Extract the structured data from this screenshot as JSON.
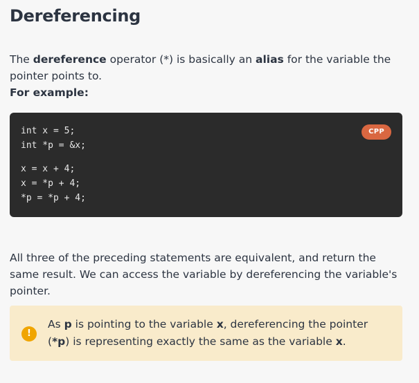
{
  "title": "Dereferencing",
  "intro": {
    "p1": "The ",
    "term_dereference": "dereference",
    "p2": " operator (*) is basically an ",
    "term_alias": "alias",
    "p3": " for the variable the pointer points to."
  },
  "example_label": "For example:",
  "code": {
    "language_badge": "CPP",
    "group1": [
      "int x = 5;",
      "int *p = &x;"
    ],
    "group2": [
      "x = x + 4;",
      "x = *p + 4;",
      "*p = *p + 4;"
    ]
  },
  "summary": "All three of the preceding statements are equivalent, and return the same result. We can access the variable by dereferencing the variable's pointer.",
  "callout": {
    "icon": "warning-icon",
    "icon_glyph": "!",
    "s1": "As ",
    "b1": "p",
    "s2": " is pointing to the variable ",
    "b2": "x",
    "s3": ", dereferencing the pointer (",
    "b3": "*p",
    "s4": ") is representing exactly the same as the variable ",
    "b4": "x",
    "s5": "."
  },
  "colors": {
    "background": "#f7f7f7",
    "code_background": "#2b2b2b",
    "badge": "#d96741",
    "callout_background": "#f9ebcb",
    "callout_icon": "#f0a500",
    "text": "#2c3441"
  }
}
